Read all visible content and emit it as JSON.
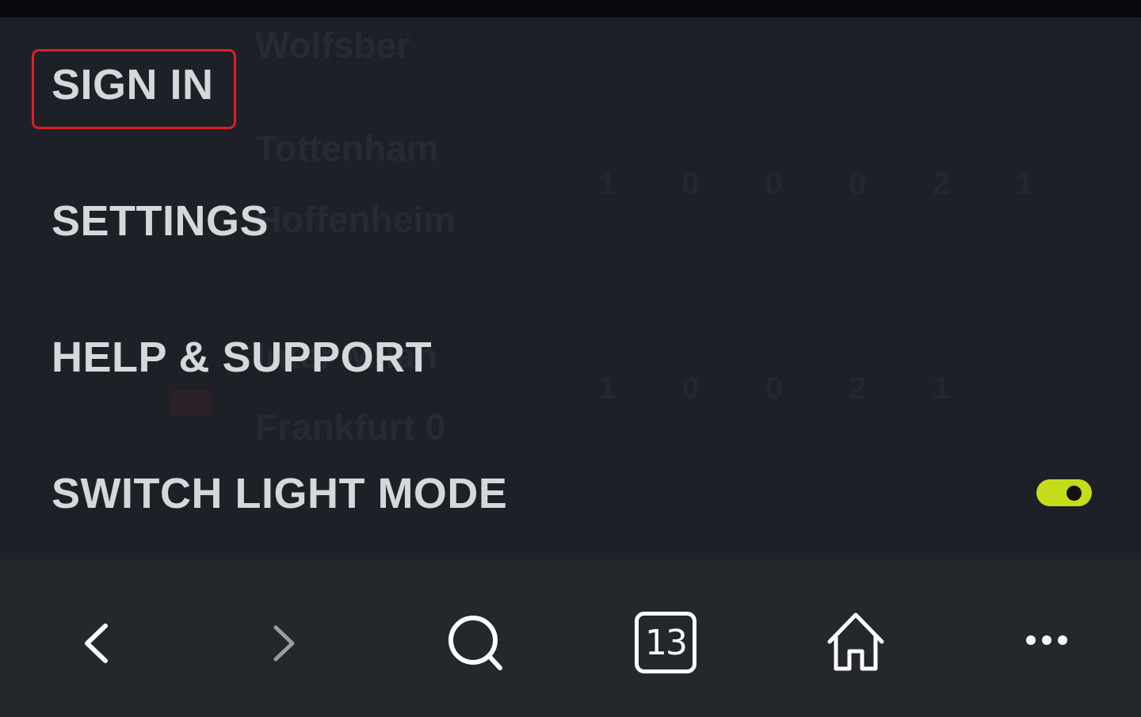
{
  "menu": {
    "items": [
      {
        "label": "SIGN IN"
      },
      {
        "label": "SETTINGS"
      },
      {
        "label": "HELP & SUPPORT"
      },
      {
        "label": "SWITCH LIGHT MODE"
      }
    ],
    "light_mode_toggle": {
      "on": true,
      "color": "#c5dc1b"
    }
  },
  "background_content": {
    "lines": [
      "Wolfsber",
      "Tottenham",
      "Hoffenheim",
      "Inter Milan",
      "Frankfurt 0"
    ],
    "score_rows": [
      "1 0 0 0 2 1",
      "1 0 0 2 1"
    ]
  },
  "bottom_nav": {
    "tab_count": "13",
    "icons": [
      "back-icon",
      "forward-icon",
      "search-icon",
      "tabs-icon",
      "home-icon",
      "more-icon"
    ]
  },
  "colors": {
    "panel_bg": "#1d2027",
    "bar_bg": "#24272b",
    "text": "#d6d7db",
    "highlight": "#e01d25"
  }
}
